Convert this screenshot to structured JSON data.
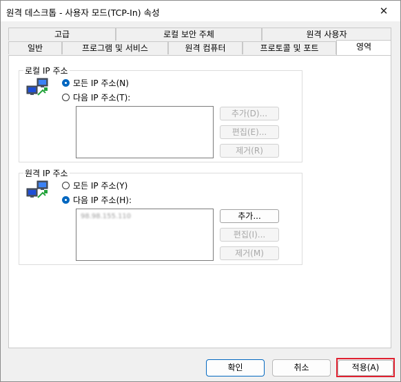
{
  "window": {
    "title": "원격 데스크톱 - 사용자 모드(TCP-In) 속성",
    "close_glyph": "✕"
  },
  "tabs_back": [
    {
      "label": "고급"
    },
    {
      "label": "로컬 보안 주체"
    },
    {
      "label": "원격 사용자"
    }
  ],
  "tabs_front": [
    {
      "label": "일반"
    },
    {
      "label": "프로그램 및 서비스"
    },
    {
      "label": "원격 컴퓨터"
    },
    {
      "label": "프로토콜 및 포트"
    },
    {
      "label": "영역",
      "active": true
    }
  ],
  "local": {
    "group_label": "로컬 IP 주소",
    "icon": "network-computers-icon",
    "any_label": "모든 IP 주소(N)",
    "specific_label": "다음 IP 주소(T):",
    "selected": "any",
    "addresses": [],
    "add_label": "추가(D)...",
    "edit_label": "편집(E)...",
    "remove_label": "제거(R)"
  },
  "remote": {
    "group_label": "원격 IP 주소",
    "icon": "network-computers-icon",
    "any_label": "모든 IP 주소(Y)",
    "specific_label": "다음 IP 주소(H):",
    "selected": "specific",
    "addresses": [
      "98.98.155.110"
    ],
    "add_label": "추가...",
    "edit_label": "편집(I)...",
    "remove_label": "제거(M)"
  },
  "footer": {
    "ok_label": "확인",
    "cancel_label": "취소",
    "apply_label": "적용(A)"
  },
  "colors": {
    "accent": "#0067c0",
    "highlight": "#e0202f"
  }
}
